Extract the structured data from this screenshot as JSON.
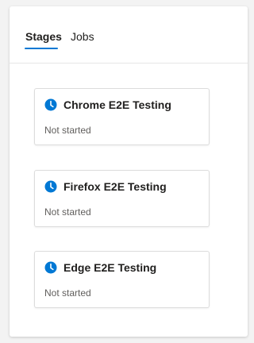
{
  "tabs": [
    {
      "label": "Stages",
      "selected": true
    },
    {
      "label": "Jobs",
      "selected": false
    }
  ],
  "stages": [
    {
      "title": "Chrome E2E Testing",
      "status": "Not started",
      "icon": "clock-icon"
    },
    {
      "title": "Firefox E2E Testing",
      "status": "Not started",
      "icon": "clock-icon"
    },
    {
      "title": "Edge E2E Testing",
      "status": "Not started",
      "icon": "clock-icon"
    }
  ],
  "colors": {
    "accent": "#0078d4",
    "text": "#201f1e",
    "muted": "#605e5c",
    "border": "#dcdcdc"
  }
}
